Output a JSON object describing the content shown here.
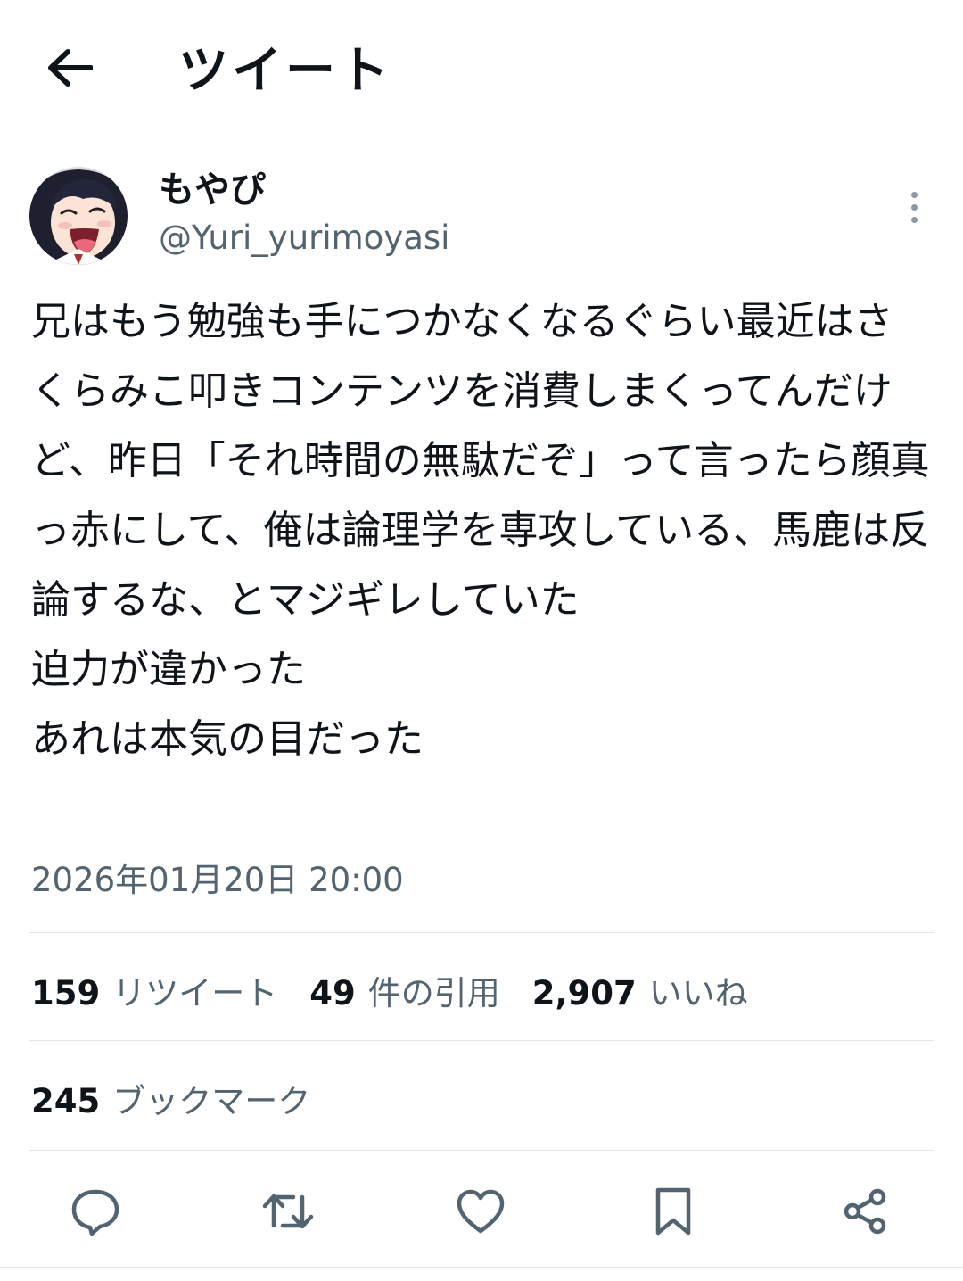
{
  "header": {
    "title": "ツイート",
    "back_icon": "arrow-left-icon"
  },
  "author": {
    "display_name": "もやぴ",
    "handle": "@Yuri_yurimoyasi",
    "avatar": "anime-girl-avatar"
  },
  "tweet": {
    "text": "兄はもう勉強も手につかなくなるぐらい最近はさくらみこ叩きコンテンツを消費しまくってんだけど、昨日「それ時間の無駄だぞ」って言ったら顔真っ赤にして、俺は論理学を専攻している、馬鹿は反論するな、とマジギレしていた\n迫力が違かった\nあれは本気の目だった",
    "timestamp": "2026年01月20日 20:00"
  },
  "stats": {
    "retweets": {
      "count": "159",
      "label": "リツイート"
    },
    "quotes": {
      "count": "49",
      "label": "件の引用"
    },
    "likes": {
      "count": "2,907",
      "label": "いいね"
    },
    "bookmarks": {
      "count": "245",
      "label": "ブックマーク"
    }
  },
  "actions": [
    "reply-icon",
    "retweet-icon",
    "like-icon",
    "bookmark-icon",
    "share-icon"
  ],
  "colors": {
    "text": "#0f1419",
    "secondary": "#536471",
    "divider": "#e3e6e8",
    "icon": "#536471"
  }
}
